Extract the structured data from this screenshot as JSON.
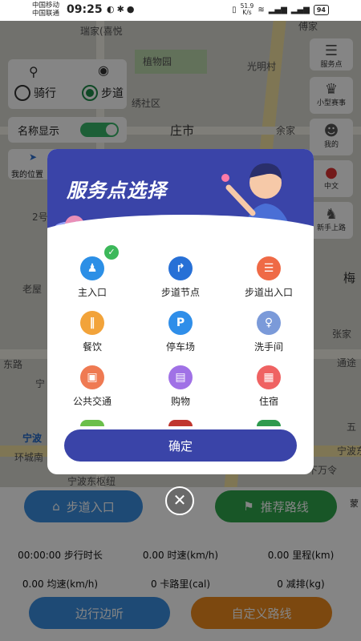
{
  "status_bar": {
    "carrier1": "中国移动",
    "carrier2": "中国联通",
    "time": "09:25",
    "net_speed_value": "51.9",
    "net_speed_unit": "K/s",
    "battery": "94"
  },
  "map": {
    "labels": [
      "瑞家(喜悦",
      "植物园",
      "光明村",
      "傅家",
      "绣社区",
      "庄市",
      "余家",
      "宁",
      "老屋",
      "梅",
      "张家",
      "东路",
      "通途",
      "宁",
      "五",
      "宁波",
      "宁波东",
      "环城南",
      "宁波东枢纽",
      "下万令",
      "2号"
    ]
  },
  "controls": {
    "mode_bike": "骑行",
    "mode_walk": "步道",
    "name_display": "名称显示",
    "my_location": "我的位置"
  },
  "side_buttons": [
    {
      "label": "服务点",
      "icon": "list-icon"
    },
    {
      "label": "小型赛事",
      "icon": "trophy-icon"
    },
    {
      "label": "我的",
      "icon": "user-icon"
    },
    {
      "label": "中文",
      "icon": "language-icon"
    },
    {
      "label": "新手上路",
      "icon": "guide-icon"
    }
  ],
  "modal": {
    "title": "服务点选择",
    "items": [
      {
        "label": "主入口",
        "color": "#2c8fe6",
        "glyph": "♟",
        "selected": true
      },
      {
        "label": "步道节点",
        "color": "#2770d6",
        "glyph": "↱",
        "selected": false
      },
      {
        "label": "步道出入口",
        "color": "#ef6a46",
        "glyph": "☰",
        "selected": false
      },
      {
        "label": "餐饮",
        "color": "#f2a33a",
        "glyph": "‖",
        "selected": false
      },
      {
        "label": "停车场",
        "color": "#2f8ee9",
        "glyph": "P",
        "selected": false
      },
      {
        "label": "洗手间",
        "color": "#7b9ad9",
        "glyph": "♀",
        "selected": false
      },
      {
        "label": "公共交通",
        "color": "#ef7a52",
        "glyph": "▣",
        "selected": false
      },
      {
        "label": "购物",
        "color": "#a071e6",
        "glyph": "▤",
        "selected": false
      },
      {
        "label": "住宿",
        "color": "#ef6262",
        "glyph": "▦",
        "selected": false
      }
    ],
    "confirm_label": "确定"
  },
  "bottom": {
    "entry_label": "步道入口",
    "route_label": "推荐路线",
    "more_label": "蒙",
    "stats_row1": [
      "00:00:00 步行时长",
      "0.00 时速(km/h)",
      "0.00 里程(km)"
    ],
    "stats_row2": [
      "0.00 均速(km/h)",
      "0 卡路里(cal)",
      "0 减排(kg)"
    ],
    "listen_label": "边行边听",
    "custom_label": "自定义路线"
  },
  "colors": {
    "primary": "#3a44a8",
    "blue": "#3a8ee0",
    "green": "#2ea54c",
    "orange": "#ee8a1e"
  }
}
